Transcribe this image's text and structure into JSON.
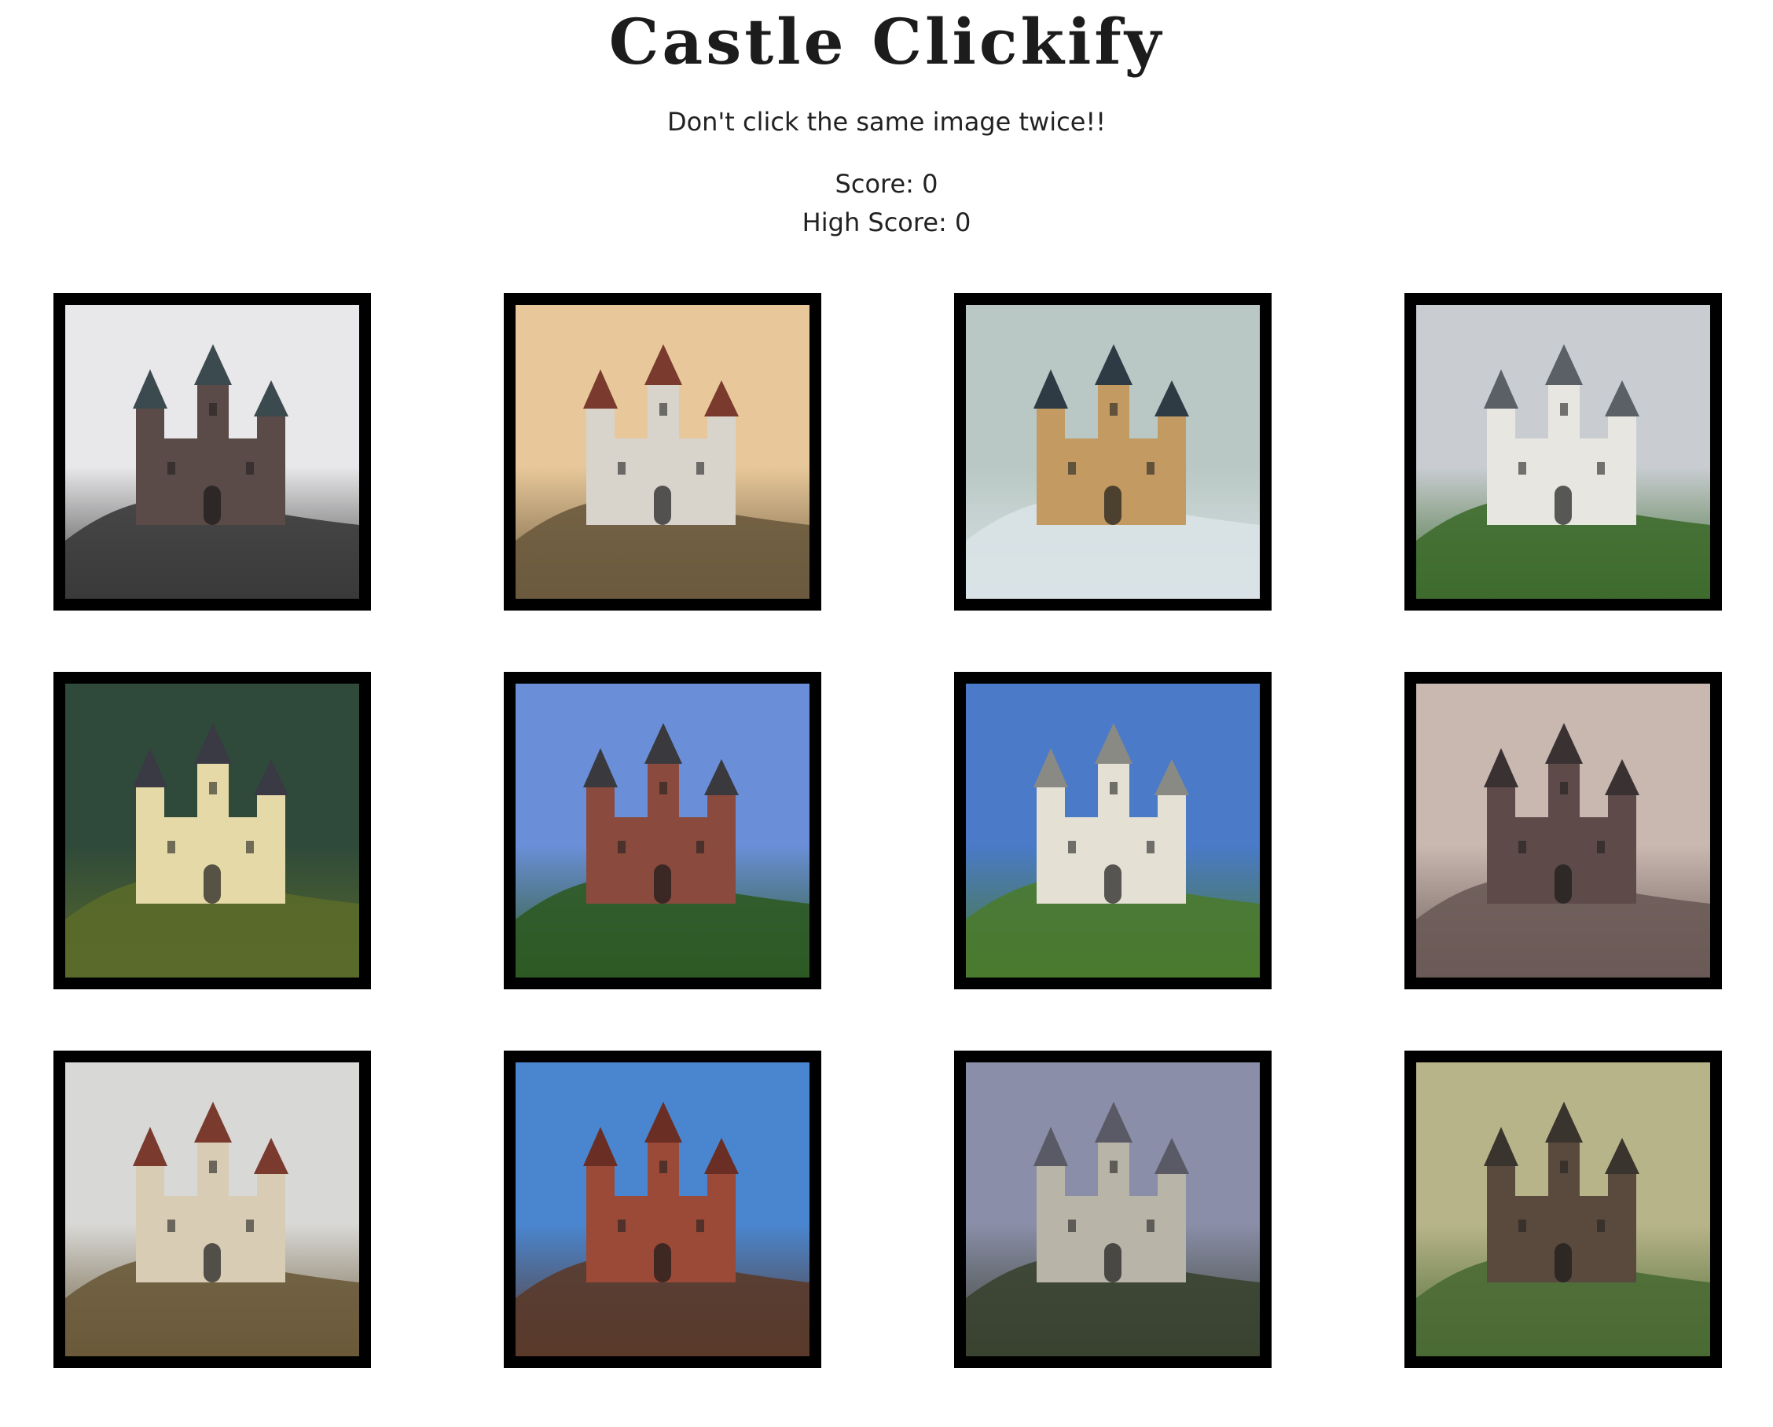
{
  "header": {
    "title": "Castle Clickify",
    "subtitle": "Don't click the same image twice!!"
  },
  "scoreboard": {
    "score_label": "Score: 0",
    "high_score_label": "High Score: 0",
    "score": 0,
    "high_score": 0
  },
  "cards": [
    {
      "name": "castle-eltz-image",
      "sky": "#e8e8ea",
      "ground": "#3a3a3a",
      "castle": "#5a4a48",
      "roof": "#3b4a4e"
    },
    {
      "name": "castle-reflection-lake-image",
      "sky": "#e8c89a",
      "ground": "#6b5a3e",
      "castle": "#d8d4cc",
      "roof": "#7a3b2e"
    },
    {
      "name": "castle-hohenzollern-fog-image",
      "sky": "#b9c8c4",
      "ground": "#d9e2e6",
      "castle": "#c29a62",
      "roof": "#2e3b44"
    },
    {
      "name": "castle-neuschwanstein-image",
      "sky": "#c9cdd2",
      "ground": "#3e6b2e",
      "castle": "#e8e6e0",
      "roof": "#5a6066"
    },
    {
      "name": "castle-forest-hillside-image",
      "sky": "#2f4a3a",
      "ground": "#5a6a2a",
      "castle": "#e6d9a8",
      "roof": "#3a3a44"
    },
    {
      "name": "castle-moyland-image",
      "sky": "#6a8fd8",
      "ground": "#2e5a24",
      "castle": "#8a4a3e",
      "roof": "#3a3a3e"
    },
    {
      "name": "castle-stolzenfels-image",
      "sky": "#4a7ac8",
      "ground": "#4a7a2e",
      "castle": "#e4e0d4",
      "roof": "#8a8a84"
    },
    {
      "name": "castle-tower-ruin-image",
      "sky": "#c8b8b0",
      "ground": "#6a5a56",
      "castle": "#5e4a48",
      "roof": "#3a3232"
    },
    {
      "name": "castle-sigmaringen-image",
      "sky": "#d8d8d6",
      "ground": "#6a5a3a",
      "castle": "#d8ccb4",
      "roof": "#7a3a2e"
    },
    {
      "name": "castle-heidelberg-ruin-image",
      "sky": "#4a86d0",
      "ground": "#5a3a2a",
      "castle": "#9a4a36",
      "roof": "#6a2e24"
    },
    {
      "name": "castle-lichtenstein-image",
      "sky": "#8a8ea8",
      "ground": "#3a4230",
      "castle": "#b8b4a8",
      "roof": "#5a5a66"
    },
    {
      "name": "castle-cochem-hill-image",
      "sky": "#b8b48a",
      "ground": "#4a6a34",
      "castle": "#5a4a3e",
      "roof": "#3a342e"
    }
  ]
}
